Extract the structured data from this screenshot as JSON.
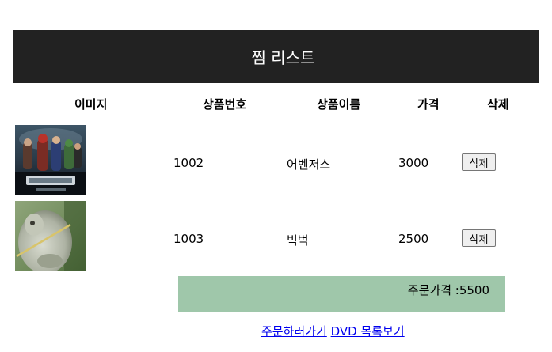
{
  "header": {
    "title": "찜 리스트"
  },
  "table": {
    "columns": [
      "이미지",
      "상품번호",
      "상품이름",
      "가격",
      "삭제"
    ],
    "rows": [
      {
        "image": "어벤져스 DVD cover",
        "number": "1002",
        "name": "어벤저스",
        "price": "3000",
        "delete_label": "삭제"
      },
      {
        "image": "빅벅 DVD cover",
        "number": "1003",
        "name": "빅벅",
        "price": "2500",
        "delete_label": "삭제"
      }
    ]
  },
  "total": {
    "label": "주문가격 :5500"
  },
  "links": {
    "order": "주문하러가기",
    "dvd_list": "DVD 목록보기"
  }
}
